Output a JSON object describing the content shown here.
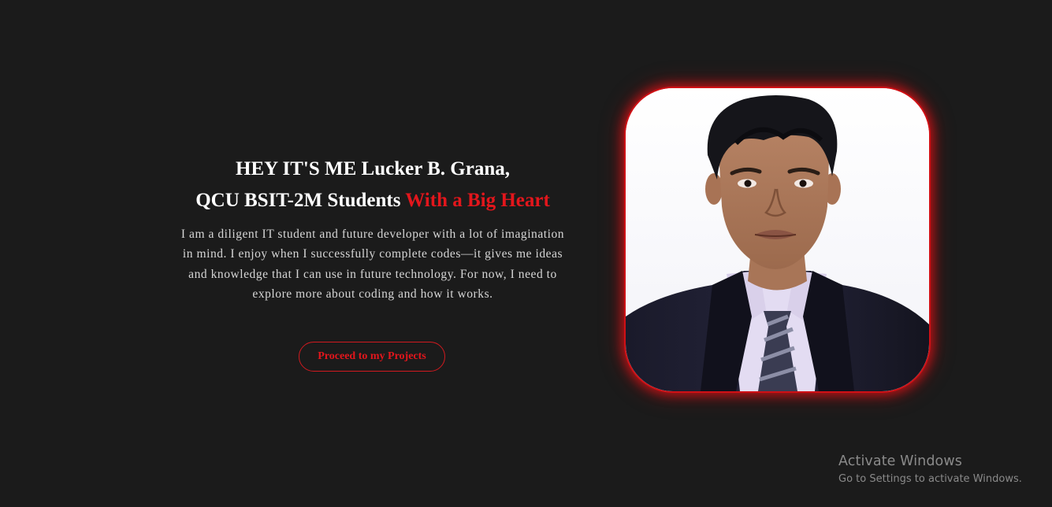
{
  "hero": {
    "line1": "HEY IT'S ME Lucker B. Grana,",
    "line2_prefix": "QCU BSIT-2M Students ",
    "line2_accent": "With a Big Heart",
    "bio": "I am a diligent IT student and future developer with a lot of imagination in mind. I enjoy when I successfully complete codes—it gives me ideas and knowledge that I can use in future technology. For now, I need to explore more about coding and how it works.",
    "cta_label": "Proceed to my Projects"
  },
  "colors": {
    "background": "#1b1b1b",
    "accent": "#e3161c",
    "text": "#ffffff",
    "muted_text": "#d6d6d6"
  },
  "watermark": {
    "title": "Activate Windows",
    "subtitle": "Go to Settings to activate Windows."
  }
}
